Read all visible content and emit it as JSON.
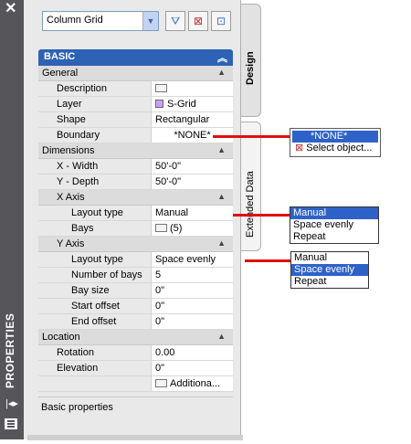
{
  "window": {
    "close_icon": "close-icon",
    "title": "PROPERTIES"
  },
  "toolbar": {
    "dropdown_value": "Column Grid",
    "buttons": [
      "quick-select-icon",
      "toggle-pickadd-icon",
      "select-objects-icon"
    ]
  },
  "grid": {
    "section_title": "BASIC",
    "general": {
      "label": "General",
      "rows": [
        {
          "name": "Description",
          "value": ""
        },
        {
          "name": "Layer",
          "value": "S-Grid"
        },
        {
          "name": "Shape",
          "value": "Rectangular"
        },
        {
          "name": "Boundary",
          "value": "*NONE*"
        }
      ]
    },
    "dimensions": {
      "label": "Dimensions",
      "rows": [
        {
          "name": "X - Width",
          "value": "50'-0\""
        },
        {
          "name": "Y - Depth",
          "value": "50'-0\""
        }
      ],
      "x_axis": {
        "label": "X Axis",
        "rows": [
          {
            "name": "Layout type",
            "value": "Manual"
          },
          {
            "name": "Bays",
            "value": "(5)"
          }
        ]
      },
      "y_axis": {
        "label": "Y Axis",
        "rows": [
          {
            "name": "Layout type",
            "value": "Space evenly"
          },
          {
            "name": "Number of bays",
            "value": "5"
          },
          {
            "name": "Bay size",
            "value": "0\""
          },
          {
            "name": "Start offset",
            "value": "0\""
          },
          {
            "name": "End offset",
            "value": "0\""
          }
        ]
      }
    },
    "location": {
      "label": "Location",
      "rows": [
        {
          "name": "Rotation",
          "value": "0.00"
        },
        {
          "name": "Elevation",
          "value": "0\""
        },
        {
          "name": "",
          "value": "Additiona..."
        }
      ]
    },
    "description_text": "Basic properties"
  },
  "tabs": {
    "design": "Design",
    "extended": "Extended Data"
  },
  "popups": {
    "boundary": {
      "items": [
        "*NONE*",
        "Select object..."
      ],
      "selected": 0
    },
    "x_layout": {
      "items": [
        "Manual",
        "Space evenly",
        "Repeat"
      ],
      "selected": 0
    },
    "y_layout": {
      "items": [
        "Manual",
        "Space evenly",
        "Repeat"
      ],
      "selected": 1
    }
  },
  "colors": {
    "section_header": "#2d62b4",
    "selection": "#2e62c9",
    "callout_line": "#e01010",
    "layer_swatch": "#c9a0ff"
  }
}
